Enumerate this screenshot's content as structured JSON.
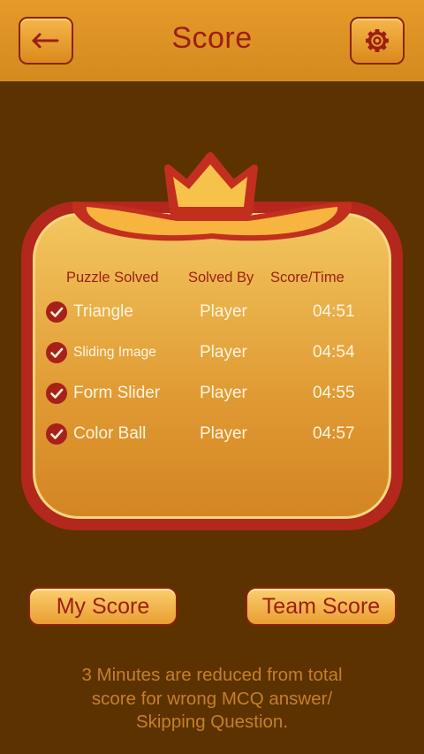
{
  "header": {
    "title": "Score"
  },
  "table": {
    "headers": [
      "Puzzle Solved",
      "Solved By",
      "Score/Time"
    ],
    "rows": [
      {
        "puzzle": "Triangle",
        "solved_by": "Player",
        "time": "04:51"
      },
      {
        "puzzle": "Sliding Image",
        "solved_by": "Player",
        "time": "04:54"
      },
      {
        "puzzle": "Form Slider",
        "solved_by": "Player",
        "time": "04:55"
      },
      {
        "puzzle": "Color Ball",
        "solved_by": "Player",
        "time": "04:57"
      }
    ]
  },
  "buttons": {
    "my_score": "My Score",
    "team_score": "Team Score"
  },
  "note": {
    "line1": "3 Minutes are reduced from total",
    "line2": "score for wrong MCQ answer/",
    "line3": "Skipping Question."
  },
  "icons": {
    "back": "back-arrow-icon",
    "settings": "gear-icon",
    "crown": "crown-icon",
    "check": "check-circle-icon"
  },
  "colors": {
    "background": "#5c3200",
    "topbar": "#e69a2a",
    "accent_red": "#9c1f12",
    "panel_border": "#b3271c",
    "note_text": "#c47f28"
  }
}
